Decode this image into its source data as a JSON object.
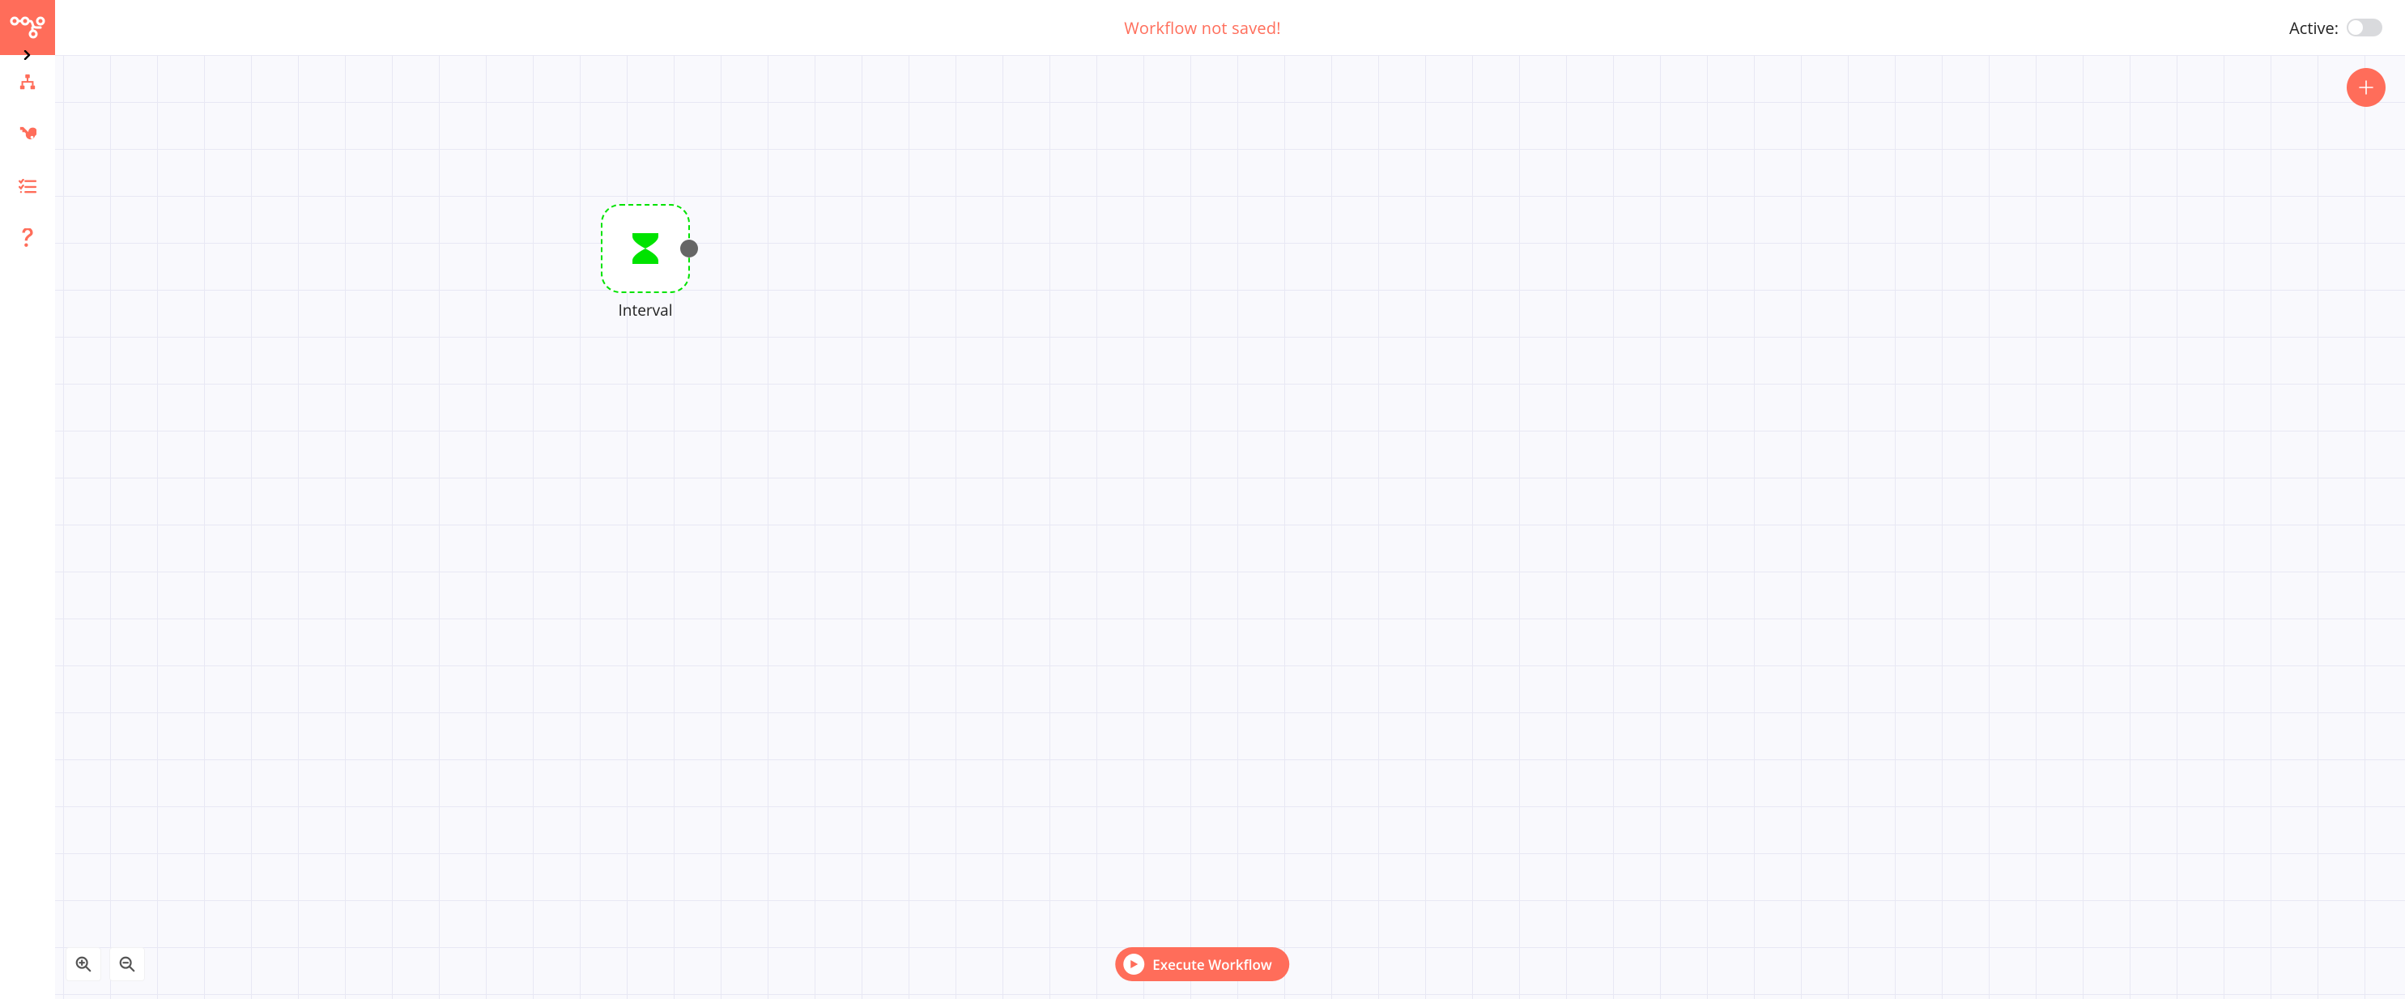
{
  "header": {
    "status_text": "Workflow not saved!",
    "active_label": "Active:",
    "active_value": false
  },
  "sidebar": {
    "logo": "n8n-logo",
    "items": [
      {
        "id": "workflows",
        "icon": "workflows-icon"
      },
      {
        "id": "credentials",
        "icon": "key-icon"
      },
      {
        "id": "executions",
        "icon": "list-check-icon"
      },
      {
        "id": "help",
        "icon": "question-icon"
      }
    ]
  },
  "canvas": {
    "nodes": [
      {
        "id": "interval",
        "label": "Interval",
        "icon": "hourglass-icon"
      }
    ]
  },
  "actions": {
    "execute_label": "Execute Workflow",
    "add_node": "+"
  },
  "controls": {
    "zoom_in": "zoom-in",
    "zoom_out": "zoom-out"
  },
  "colors": {
    "accent": "#ff6d5a",
    "node_green": "#00e300"
  }
}
